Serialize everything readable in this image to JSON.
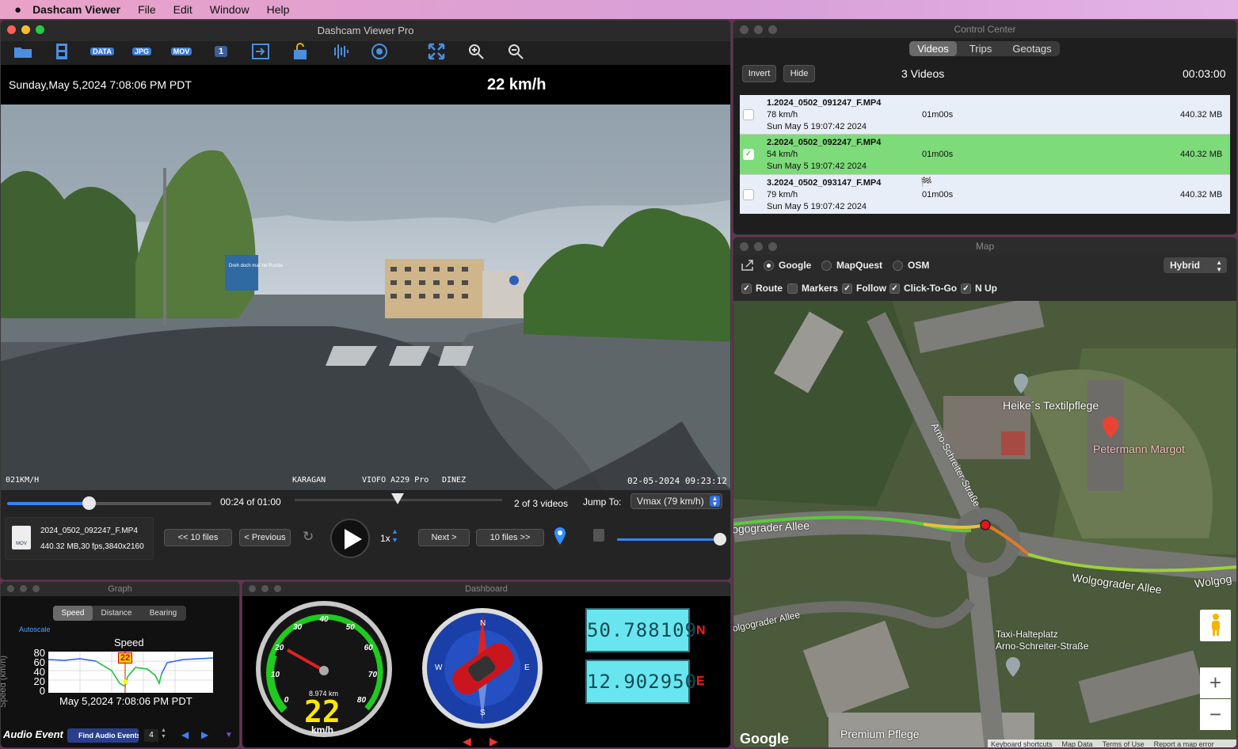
{
  "menubar": {
    "app": "Dashcam Viewer",
    "items": [
      "File",
      "Edit",
      "Window",
      "Help"
    ]
  },
  "main": {
    "title": "Dashcam Viewer Pro",
    "toolbar": [
      "folder-icon",
      "filmstrip-icon",
      "DATA",
      "JPG",
      "MOV",
      "1",
      "export-icon",
      "lock-icon",
      "audio-icon",
      "target-icon",
      "fullscreen-icon",
      "zoom-in-icon",
      "zoom-out-icon"
    ],
    "datetime": "Sunday,May 5,2024 7:08:06 PM PDT",
    "speed": "22 km/h",
    "overlay": {
      "left": "021KM/H",
      "center1": "KARAGAN",
      "center2": "VIOFO A229 Pro",
      "center3": "DINEZ",
      "right": "02-05-2024 09:23:12"
    },
    "sign": "Dreh doch mal 'ne Runde",
    "time": "00:24 of 01:00",
    "playback_progress": 0.4,
    "videos_of": "2 of 3 videos",
    "jump_label": "Jump To:",
    "jump_value": "Vmax (79 km/h)",
    "file_name": "2024_0502_092247_F.MP4",
    "file_info": "440.32 MB,30 fps,3840x2160",
    "file_icon": "MOV",
    "btn_10back": "<< 10 files",
    "btn_prev": "< Previous",
    "rate": "1x",
    "btn_next": "Next >",
    "btn_10fwd": "10 files >>",
    "volume": 1.0
  },
  "control": {
    "title": "Control Center",
    "tabs": [
      "Videos",
      "Trips",
      "Geotags"
    ],
    "active_tab": "Videos",
    "invert": "Invert",
    "hide": "Hide",
    "count": "3 Videos",
    "duration": "00:03:00",
    "rows": [
      {
        "name": "1.2024_0502_091247_F.MP4",
        "speed": "78 km/h",
        "date": "Sun May 5 19:07:42 2024",
        "len": "01m00s",
        "size": "440.32 MB",
        "checked": false
      },
      {
        "name": "2.2024_0502_092247_F.MP4",
        "speed": "54 km/h",
        "date": "Sun May 5 19:07:42 2024",
        "len": "01m00s",
        "size": "440.32 MB",
        "checked": true
      },
      {
        "name": "3.2024_0502_093147_F.MP4",
        "speed": "79 km/h",
        "date": "Sun May 5 19:07:42 2024",
        "len": "01m00s",
        "size": "440.32 MB",
        "checked": false
      }
    ]
  },
  "map": {
    "title": "Map",
    "providers": [
      "Google",
      "MapQuest",
      "OSM"
    ],
    "provider": "Google",
    "type": "Hybrid",
    "options": [
      "Route",
      "Markers",
      "Follow",
      "Click-To-Go",
      "N Up"
    ],
    "options_checked": [
      true,
      false,
      true,
      true,
      true
    ],
    "labels": {
      "street1": "Arno-Schreiter-Straße",
      "poi1": "Heike´s Textilpflege",
      "poi2": "Petermann Margot",
      "allee1": "ogograder Allee",
      "allee2": "Wolgograder Allee",
      "allee3": "Wolgog",
      "allee4": "olgograder Allee",
      "taxi1": "Taxi-Halteplatz",
      "taxi2": "Arno-Schreiter-Straße",
      "pflege": "Premium Pflege"
    },
    "footer": [
      "Keyboard shortcuts",
      "Map Data",
      "Terms of Use",
      "Report a map error"
    ],
    "logo": "Google",
    "zoom_in": "+",
    "zoom_out": "−"
  },
  "graph": {
    "title": "Graph",
    "tabs": [
      "Speed",
      "Distance",
      "Bearing"
    ],
    "active": "Speed",
    "autoscale": "Autoscale",
    "chart_title": "Speed",
    "ylabel": "Speed (km/h)",
    "yticks": [
      "80",
      "60",
      "40",
      "20",
      "0"
    ],
    "marker": "22",
    "caption": "May 5,2024 7:08:06 PM PDT",
    "audio_label": "Audio Events",
    "find": "Find Audio Events",
    "level": "4"
  },
  "dashboard": {
    "title": "Dashboard",
    "ticks": [
      "0",
      "10",
      "20",
      "30",
      "40",
      "50",
      "60",
      "70",
      "80"
    ],
    "odo": "8.974 km",
    "speed": "22",
    "unit": "km/h",
    "compass": [
      "N",
      "E",
      "S",
      "W"
    ],
    "lat": "50.788109",
    "lat_dir": "N",
    "lon": "12.902950",
    "lon_dir": "E"
  }
}
